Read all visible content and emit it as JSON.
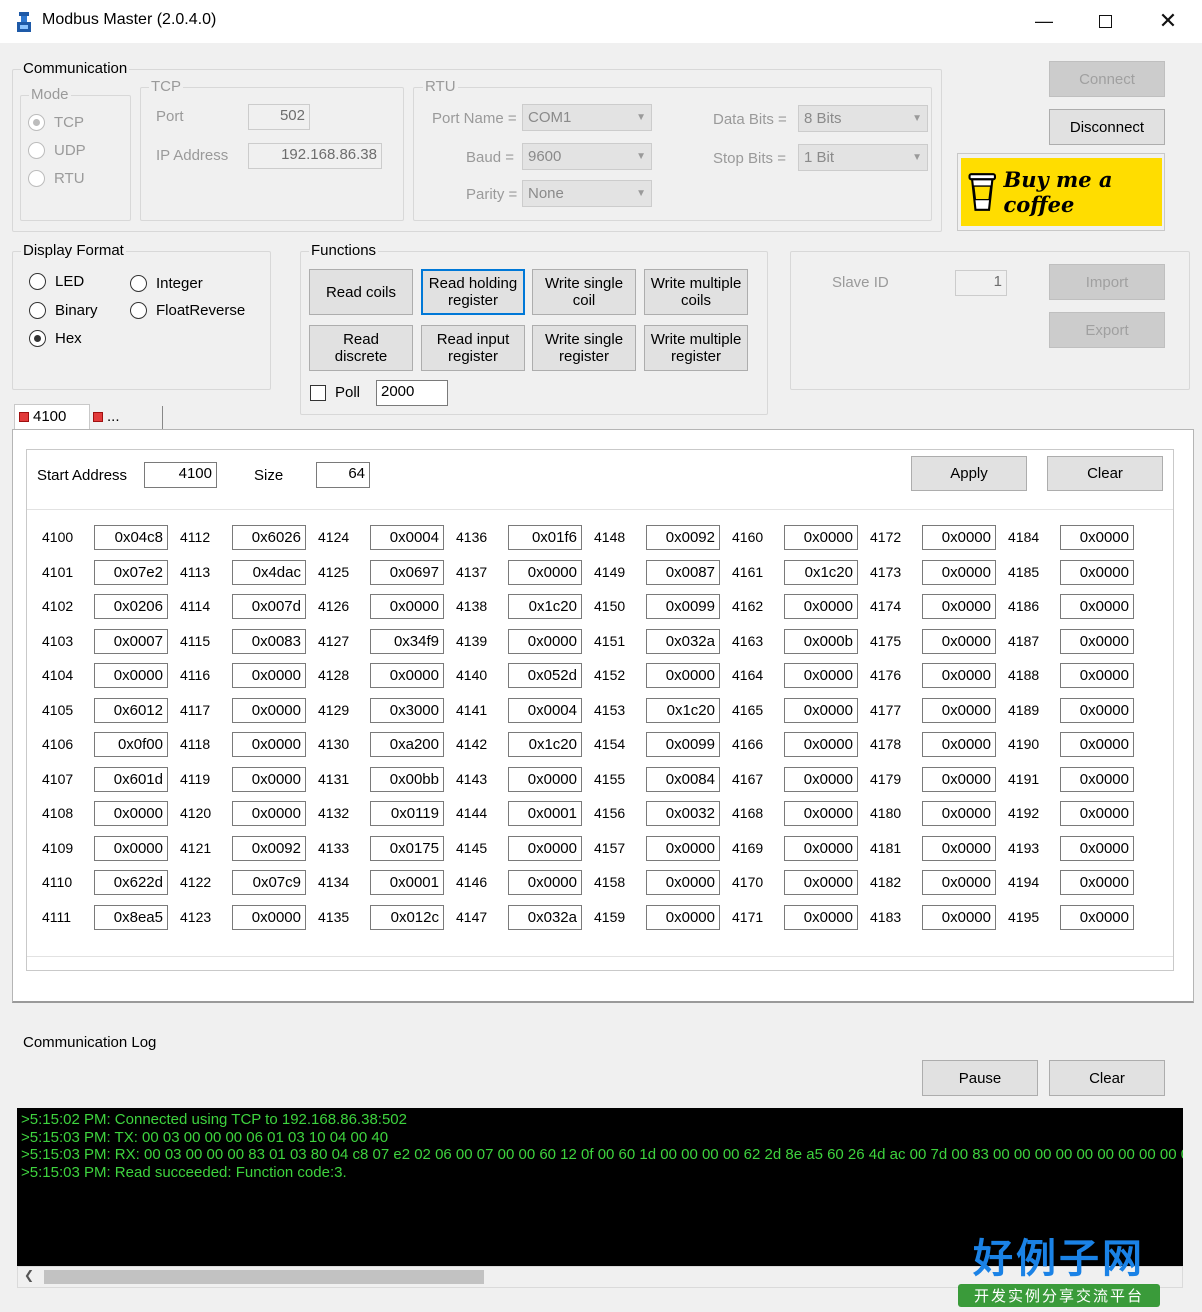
{
  "window": {
    "title": "Modbus Master (2.0.4.0)"
  },
  "communication": {
    "label": "Communication",
    "mode": {
      "label": "Mode",
      "options": [
        "TCP",
        "UDP",
        "RTU"
      ],
      "selected": "TCP"
    },
    "tcp": {
      "label": "TCP",
      "port_label": "Port",
      "port_value": "502",
      "ip_label": "IP Address",
      "ip_value": "192.168.86.38"
    },
    "rtu": {
      "label": "RTU",
      "port_name_label": "Port Name =",
      "port_name_value": "COM1",
      "baud_label": "Baud =",
      "baud_value": "9600",
      "parity_label": "Parity =",
      "parity_value": "None",
      "data_bits_label": "Data Bits =",
      "data_bits_value": "8 Bits",
      "stop_bits_label": "Stop Bits =",
      "stop_bits_value": "1 Bit"
    },
    "connect_label": "Connect",
    "disconnect_label": "Disconnect",
    "coffee_label": "Buy me a coffee"
  },
  "display_format": {
    "label": "Display Format",
    "options": [
      "LED",
      "Binary",
      "Hex",
      "Integer",
      "FloatReverse"
    ],
    "selected": "Hex"
  },
  "functions": {
    "label": "Functions",
    "read_coils": "Read coils",
    "read_holding": [
      "Read holding",
      "register"
    ],
    "write_single_coil": [
      "Write single",
      "coil"
    ],
    "write_multiple_coils": [
      "Write multiple",
      "coils"
    ],
    "read_discrete": [
      "Read",
      "discrete"
    ],
    "read_input": [
      "Read input",
      "register"
    ],
    "write_single_register": [
      "Write single",
      "register"
    ],
    "write_multiple_registers": [
      "Write multiple",
      "register"
    ],
    "poll_label": "Poll",
    "poll_value": "2000"
  },
  "slave": {
    "slave_id_label": "Slave ID",
    "slave_id_value": "1",
    "import_label": "Import",
    "export_label": "Export"
  },
  "tabs": [
    "4100",
    "..."
  ],
  "registers": {
    "start_address_label": "Start Address",
    "start_address_value": "4100",
    "size_label": "Size",
    "size_value": "64",
    "apply_label": "Apply",
    "clear_label": "Clear",
    "columns": [
      {
        "start": 4100,
        "values": [
          "0x04c8",
          "0x07e2",
          "0x0206",
          "0x0007",
          "0x0000",
          "0x6012",
          "0x0f00",
          "0x601d",
          "0x0000",
          "0x0000",
          "0x622d",
          "0x8ea5"
        ]
      },
      {
        "start": 4112,
        "values": [
          "0x6026",
          "0x4dac",
          "0x007d",
          "0x0083",
          "0x0000",
          "0x0000",
          "0x0000",
          "0x0000",
          "0x0000",
          "0x0092",
          "0x07c9",
          "0x0000"
        ]
      },
      {
        "start": 4124,
        "values": [
          "0x0004",
          "0x0697",
          "0x0000",
          "0x34f9",
          "0x0000",
          "0x3000",
          "0xa200",
          "0x00bb",
          "0x0119",
          "0x0175",
          "0x0001",
          "0x012c"
        ]
      },
      {
        "start": 4136,
        "values": [
          "0x01f6",
          "0x0000",
          "0x1c20",
          "0x0000",
          "0x052d",
          "0x0004",
          "0x1c20",
          "0x0000",
          "0x0001",
          "0x0000",
          "0x0000",
          "0x032a"
        ]
      },
      {
        "start": 4148,
        "values": [
          "0x0092",
          "0x0087",
          "0x0099",
          "0x032a",
          "0x0000",
          "0x1c20",
          "0x0099",
          "0x0084",
          "0x0032",
          "0x0000",
          "0x0000",
          "0x0000"
        ]
      },
      {
        "start": 4160,
        "values": [
          "0x0000",
          "0x1c20",
          "0x0000",
          "0x000b",
          "0x0000",
          "0x0000",
          "0x0000",
          "0x0000",
          "0x0000",
          "0x0000",
          "0x0000",
          "0x0000"
        ]
      },
      {
        "start": 4172,
        "values": [
          "0x0000",
          "0x0000",
          "0x0000",
          "0x0000",
          "0x0000",
          "0x0000",
          "0x0000",
          "0x0000",
          "0x0000",
          "0x0000",
          "0x0000",
          "0x0000"
        ]
      },
      {
        "start": 4184,
        "values": [
          "0x0000",
          "0x0000",
          "0x0000",
          "0x0000",
          "0x0000",
          "0x0000",
          "0x0000",
          "0x0000",
          "0x0000",
          "0x0000",
          "0x0000",
          "0x0000"
        ]
      }
    ]
  },
  "log": {
    "label": "Communication Log",
    "pause_label": "Pause",
    "clear_label": "Clear",
    "lines": [
      ">5:15:02 PM: Connected using TCP to 192.168.86.38:502",
      ">5:15:03 PM: TX: 00 03 00 00 00 06 01 03 10 04 00 40",
      ">5:15:03 PM: RX: 00 03 00 00 00 83 01 03 80 04 c8 07 e2 02 06 00 07 00 00 60 12 0f 00 60 1d 00 00 00 00 62 2d 8e a5 60 26 4d ac 00 7d 00 83 00 00 00 00 00 00 00 00 00 00 0",
      ">5:15:03 PM: Read succeeded: Function code:3."
    ]
  },
  "watermark": {
    "brand": "好例子网",
    "tagline": "开发实例分享交流平台"
  },
  "colors": {
    "log_bg": "#000000",
    "log_text": "#3ed33e",
    "focus": "#0078d7",
    "coffee": "#ffdd00"
  }
}
